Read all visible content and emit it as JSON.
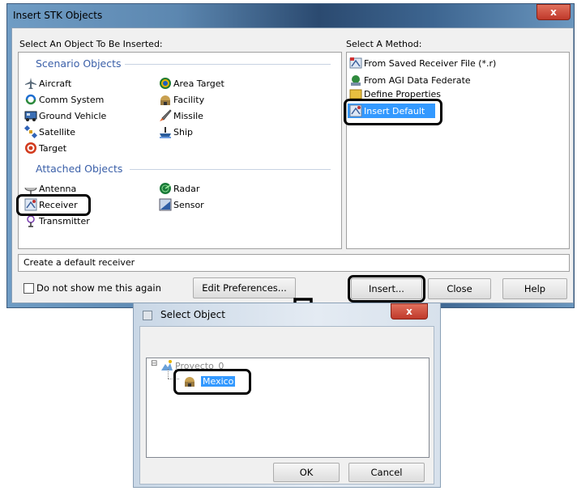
{
  "dialog1": {
    "title": "Insert STK Objects",
    "close_glyph": "x",
    "left_heading": "Select An Object To Be Inserted:",
    "right_heading": "Select A Method:",
    "scenario_section": "Scenario Objects",
    "attached_section": "Attached Objects",
    "scenario_left": [
      {
        "label": "Aircraft",
        "icon": "aircraft-icon"
      },
      {
        "label": "Comm System",
        "icon": "comm-system-icon"
      },
      {
        "label": "Ground Vehicle",
        "icon": "ground-vehicle-icon"
      },
      {
        "label": "Satellite",
        "icon": "satellite-icon"
      },
      {
        "label": "Target",
        "icon": "target-icon"
      }
    ],
    "scenario_right": [
      {
        "label": "Area Target",
        "icon": "area-target-icon"
      },
      {
        "label": "Facility",
        "icon": "facility-icon"
      },
      {
        "label": "Missile",
        "icon": "missile-icon"
      },
      {
        "label": "Ship",
        "icon": "ship-icon"
      }
    ],
    "attached_left": [
      {
        "label": "Antenna",
        "icon": "antenna-icon"
      },
      {
        "label": "Receiver",
        "icon": "receiver-icon"
      },
      {
        "label": "Transmitter",
        "icon": "transmitter-icon"
      }
    ],
    "attached_right": [
      {
        "label": "Radar",
        "icon": "radar-icon"
      },
      {
        "label": "Sensor",
        "icon": "sensor-icon"
      }
    ],
    "methods": [
      {
        "label": "From Saved Receiver File (*.r)",
        "icon": "saved-file-icon"
      },
      {
        "label": "From AGI Data Federate",
        "icon": "data-federate-icon"
      },
      {
        "label": "Define Properties",
        "icon": "define-properties-icon"
      },
      {
        "label": "Insert Default",
        "icon": "insert-default-icon",
        "selected": true
      }
    ],
    "status_text": "Create a default receiver",
    "checkbox_label": "Do not show me this again",
    "edit_prefs_label": "Edit Preferences...",
    "insert_label": "Insert...",
    "close_label": "Close",
    "help_label": "Help"
  },
  "dialog2": {
    "title": "Select Object",
    "close_glyph": "x",
    "tree_root": "Proyecto_0",
    "tree_expander": "⊟",
    "tree_child": "Mexico",
    "ok_label": "OK",
    "cancel_label": "Cancel"
  },
  "colors": {
    "section_heading": "#3a5fa8",
    "selection": "#3399ff",
    "highlight_outline": "#000000"
  }
}
